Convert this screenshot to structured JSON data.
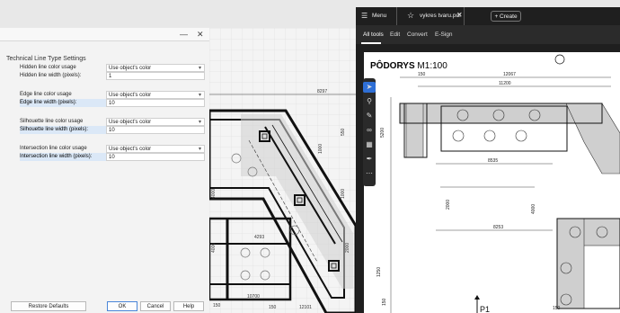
{
  "dialog": {
    "section_title": "Technical Line Type Settings",
    "rows": [
      {
        "label": "Hidden line color usage",
        "value": "Use object's color"
      },
      {
        "label": "Hidden line width (pixels):",
        "value": "1"
      },
      {
        "label": "Edge line color usage",
        "value": "Use object's color"
      },
      {
        "label": "Edge line width (pixels):",
        "value": "10"
      },
      {
        "label": "Silhouette line color usage",
        "value": "Use object's color"
      },
      {
        "label": "Silhouette line width (pixels):",
        "value": "10"
      },
      {
        "label": "Intersection line color usage",
        "value": "Use object's color"
      },
      {
        "label": "Intersection line width (pixels):",
        "value": "10"
      }
    ],
    "buttons": {
      "restore": "Restore Defaults",
      "ok": "OK",
      "cancel": "Cancel",
      "help": "Help"
    }
  },
  "viewer": {
    "menu_label": "Menu",
    "tab_title": "vykres tvaru.pdf",
    "create_label": "Create",
    "menus": [
      "All tools",
      "Edit",
      "Convert",
      "E-Sign"
    ],
    "tools": [
      "cursor-icon",
      "comment-zoom-icon",
      "pen-icon",
      "link-icon",
      "text-box-icon",
      "signature-icon",
      "more-icon"
    ],
    "page": {
      "title_bold": "PÔDORYS",
      "title_scale": "M1:100",
      "dims": [
        "150",
        "12067",
        "11200",
        "8535",
        "8253",
        "5200",
        "150",
        "P1",
        "150",
        "4000",
        "2000",
        "1250"
      ]
    }
  },
  "drawing": {
    "dims": [
      "8297",
      "4293",
      "10700",
      "12101",
      "4000",
      "4000",
      "1000",
      "2000",
      "150",
      "150",
      "550",
      "1000"
    ]
  }
}
